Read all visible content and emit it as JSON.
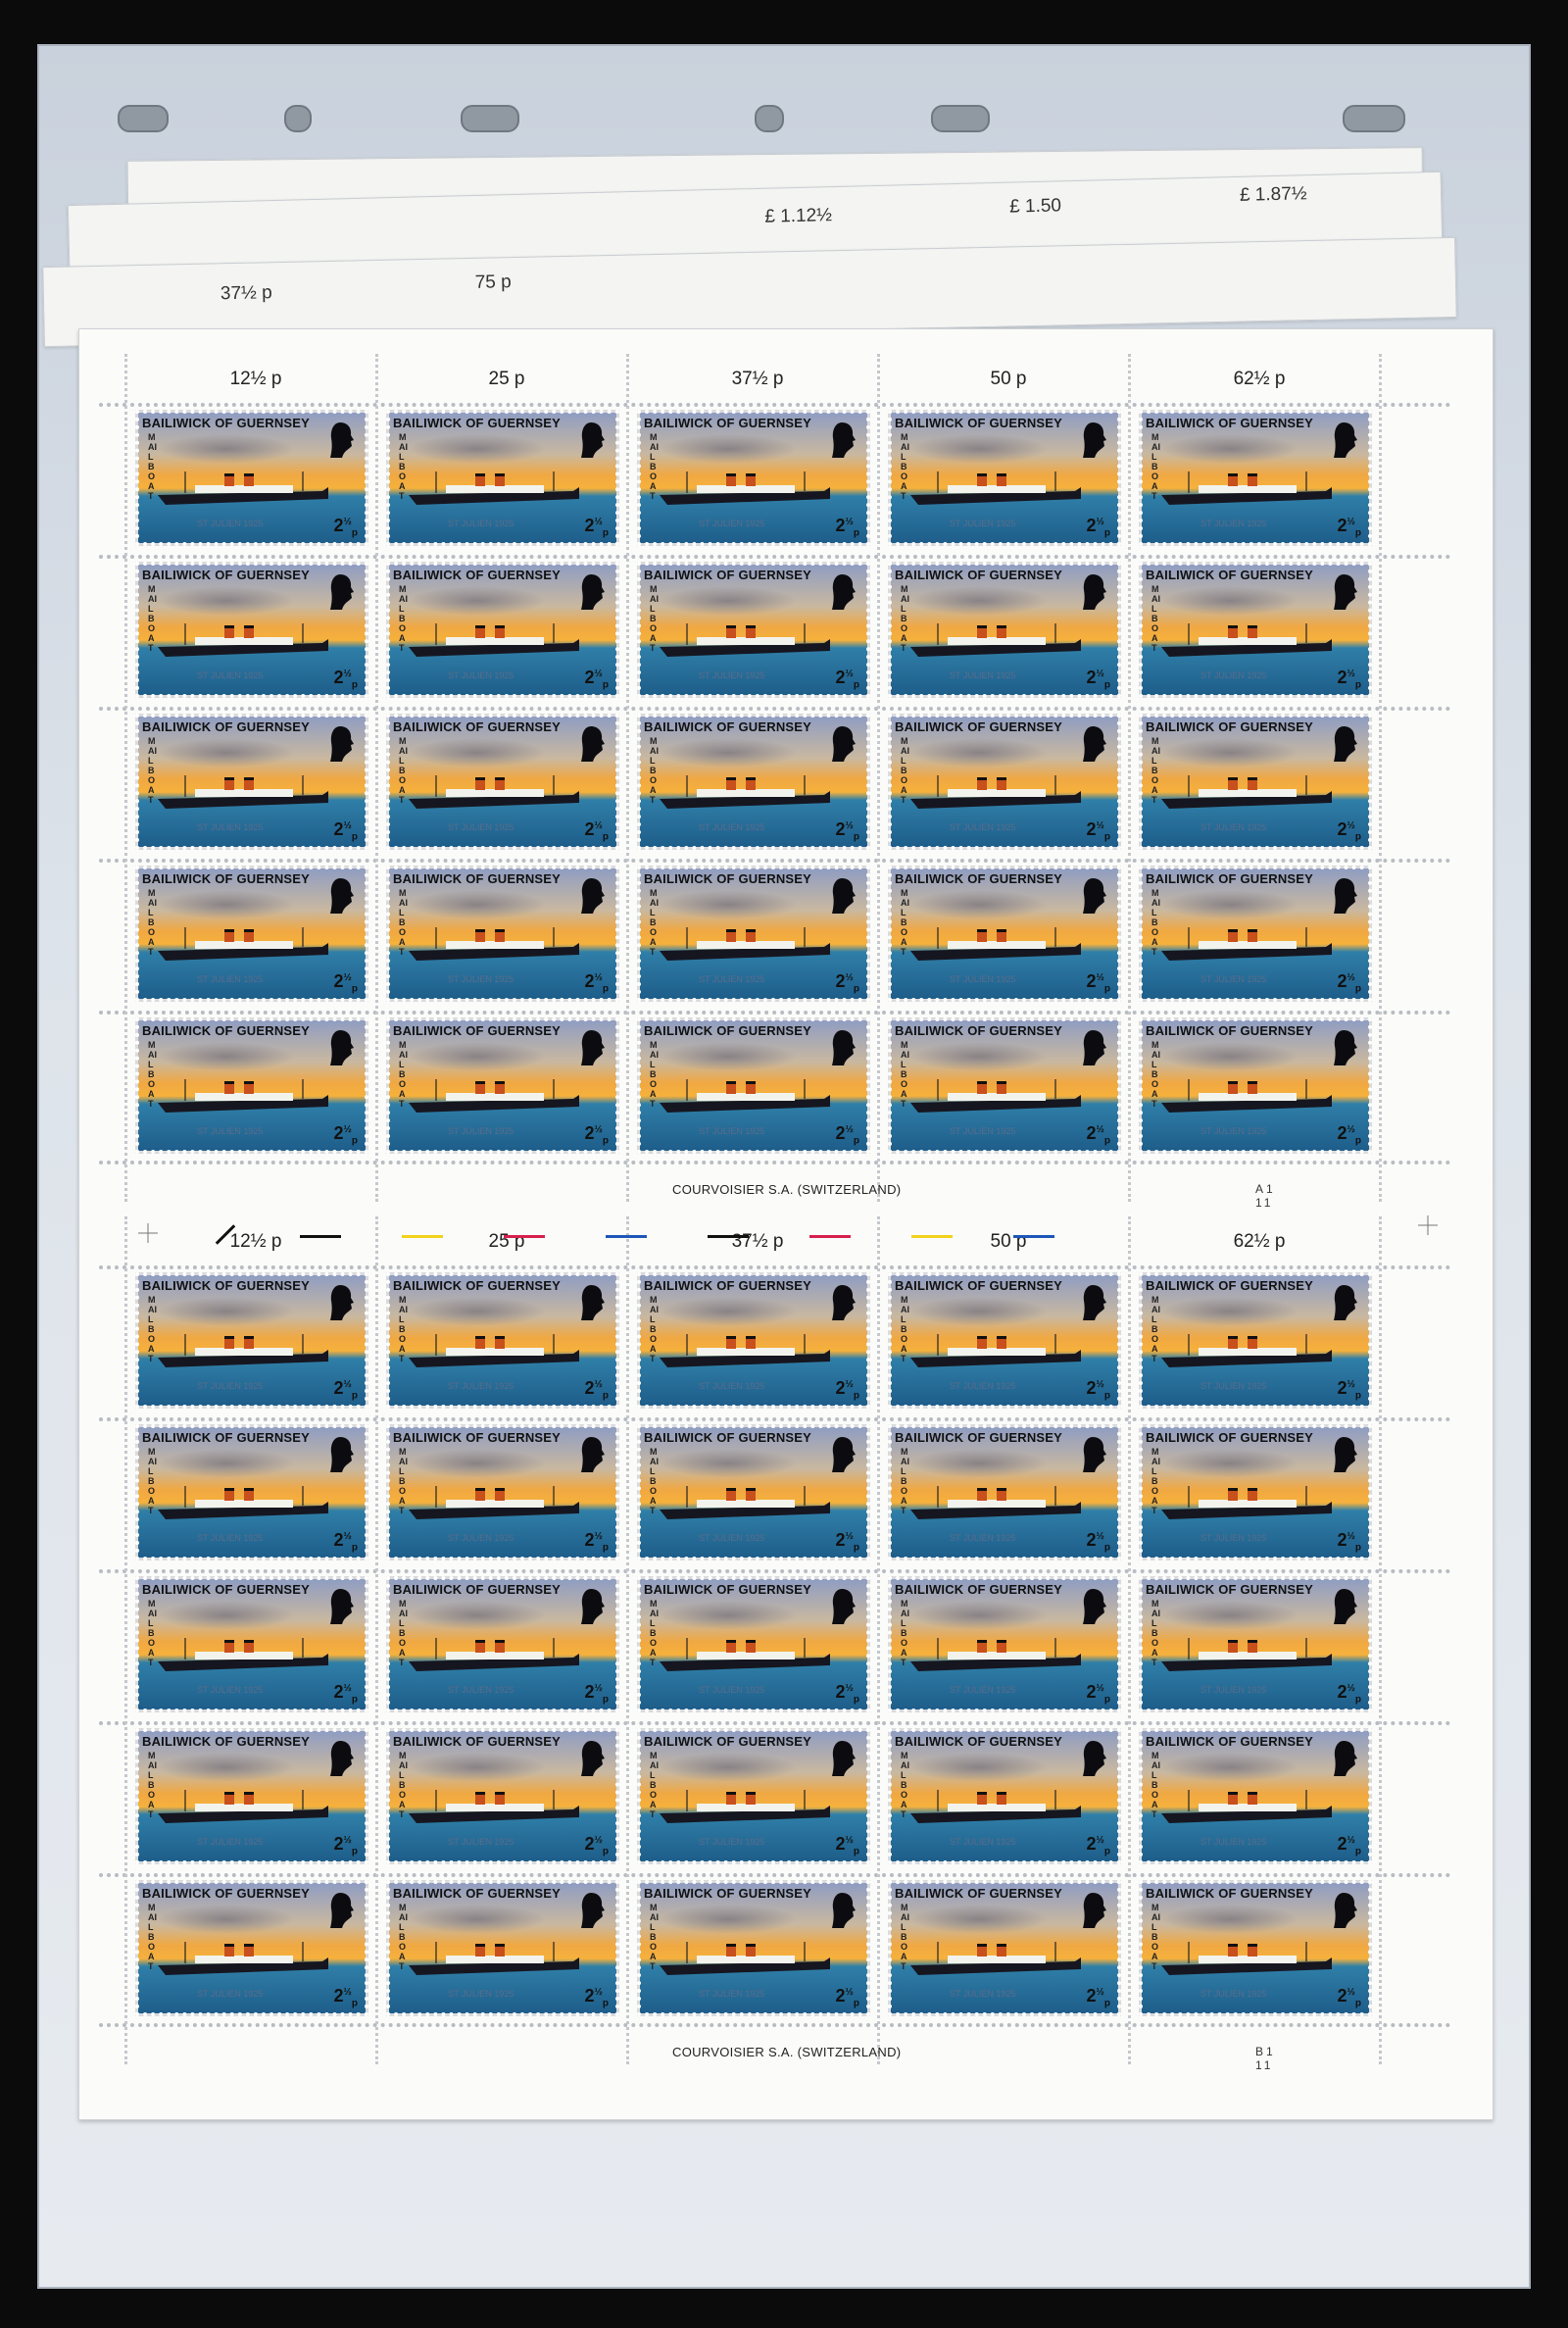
{
  "background_sheets": {
    "top_values": [
      "£ 1.12½",
      "£ 1.50",
      "£ 1.87½"
    ],
    "second_values": [
      "37½ p",
      "75 p"
    ],
    "partial_stamp_text": "BAILIWICK OF GUERNSEY"
  },
  "panes": [
    {
      "values": [
        "12½ p",
        "25 p",
        "37½ p",
        "50 p",
        "62½ p"
      ],
      "imprint": "COURVOISIER S.A.   (SWITZERLAND)",
      "control_number": "A1  11"
    },
    {
      "values": [
        "12½ p",
        "25 p",
        "37½ p",
        "50 p",
        "62½ p"
      ],
      "imprint": "COURVOISIER S.A.   (SWITZERLAND)",
      "control_number": "B1  11"
    }
  ],
  "stamp": {
    "country": "BAILIWICK OF GUERNSEY",
    "vertical_text": "MAILBOAT",
    "ship_name": "ST JULIEN 1925",
    "denomination_whole": "2",
    "denomination_fraction": "½",
    "denomination_unit": "p",
    "rows": 5,
    "cols": 5
  },
  "colour_bars": [
    "#111111",
    "#111111",
    "#f2d21b",
    "#d6204e",
    "#1d56b8",
    "#111111",
    "#d6204e",
    "#f2d21b",
    "#1d56b8"
  ]
}
